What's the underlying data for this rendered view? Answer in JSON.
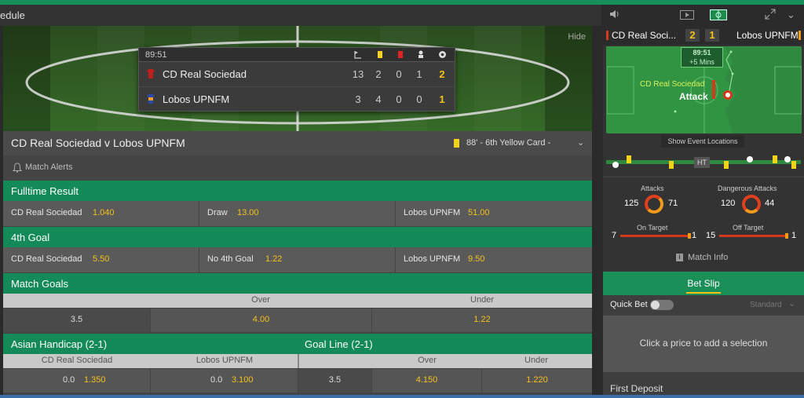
{
  "nav": {
    "left_text": "edule"
  },
  "pitch": {
    "hide_label": "Hide"
  },
  "scoreboard": {
    "clock": "89:51",
    "icons": [
      "corner-icon",
      "yellow-card-icon",
      "red-card-icon",
      "substitution-icon",
      "goal-icon"
    ],
    "teams": [
      {
        "name": "CD Real Sociedad",
        "kit_color": "#c01d1d",
        "corners": "13",
        "yellow": "2",
        "red": "0",
        "subs": "1",
        "goals": "2"
      },
      {
        "name": "Lobos UPNFM",
        "kit_color": "#2a4aa8",
        "corners": "3",
        "yellow": "4",
        "red": "0",
        "subs": "0",
        "goals": "1"
      }
    ]
  },
  "match": {
    "title": "CD Real Sociedad v Lobos UPNFM",
    "latest_event": "88' - 6th Yellow Card -",
    "alerts_label": "Match Alerts"
  },
  "markets": {
    "fulltime": {
      "title": "Fulltime Result",
      "selections": [
        {
          "name": "CD Real Sociedad",
          "odds": "1.040"
        },
        {
          "name": "Draw",
          "odds": "13.00"
        },
        {
          "name": "Lobos UPNFM",
          "odds": "51.00"
        }
      ]
    },
    "fourth_goal": {
      "title": "4th Goal",
      "selections": [
        {
          "name": "CD Real Sociedad",
          "odds": "5.50"
        },
        {
          "name": "No 4th Goal",
          "odds": "1.22"
        },
        {
          "name": "Lobos UPNFM",
          "odds": "9.50"
        }
      ]
    },
    "match_goals": {
      "title": "Match Goals",
      "over_label": "Over",
      "under_label": "Under",
      "line": "3.5",
      "over_odds": "4.00",
      "under_odds": "1.22"
    },
    "asian_handicap": {
      "title": "Asian Handicap (2-1)",
      "home_label": "CD Real Sociedad",
      "away_label": "Lobos UPNFM",
      "home_line": "0.0",
      "home_odds": "1.350",
      "away_line": "0.0",
      "away_odds": "3.100"
    },
    "goal_line": {
      "title": "Goal Line (2-1)",
      "over_label": "Over",
      "under_label": "Under",
      "line": "3.5",
      "over_odds": "4.150",
      "under_odds": "1.220"
    }
  },
  "right": {
    "score": {
      "home": "CD Real Soci...",
      "home_goals": "2",
      "away_goals": "1",
      "away": "Lobos UPNFM"
    },
    "mini_pitch": {
      "clock": "89:51",
      "added": "+5 Mins",
      "team": "CD Real Sociedad",
      "state": "Attack"
    },
    "show_locations": "Show Event Locations",
    "timeline_ht": "HT",
    "stats": {
      "attacks_label": "Attacks",
      "attacks_home": "125",
      "attacks_away": "71",
      "dangerous_label": "Dangerous Attacks",
      "dangerous_home": "120",
      "dangerous_away": "44",
      "on_target_label": "On Target",
      "on_target_home": "7",
      "on_target_away": "1",
      "off_target_label": "Off Target",
      "off_target_home": "15",
      "off_target_away": "1",
      "match_info": "Match Info"
    },
    "betslip": {
      "title": "Bet Slip",
      "quick_bet": "Quick Bet",
      "mode": "Standard",
      "empty_message": "Click a price to add a selection",
      "first_deposit": "First Deposit"
    }
  },
  "colors": {
    "accent": "#138a57",
    "odds": "#f4c21b",
    "home": "#d33a1b",
    "away": "#f29a1a"
  }
}
